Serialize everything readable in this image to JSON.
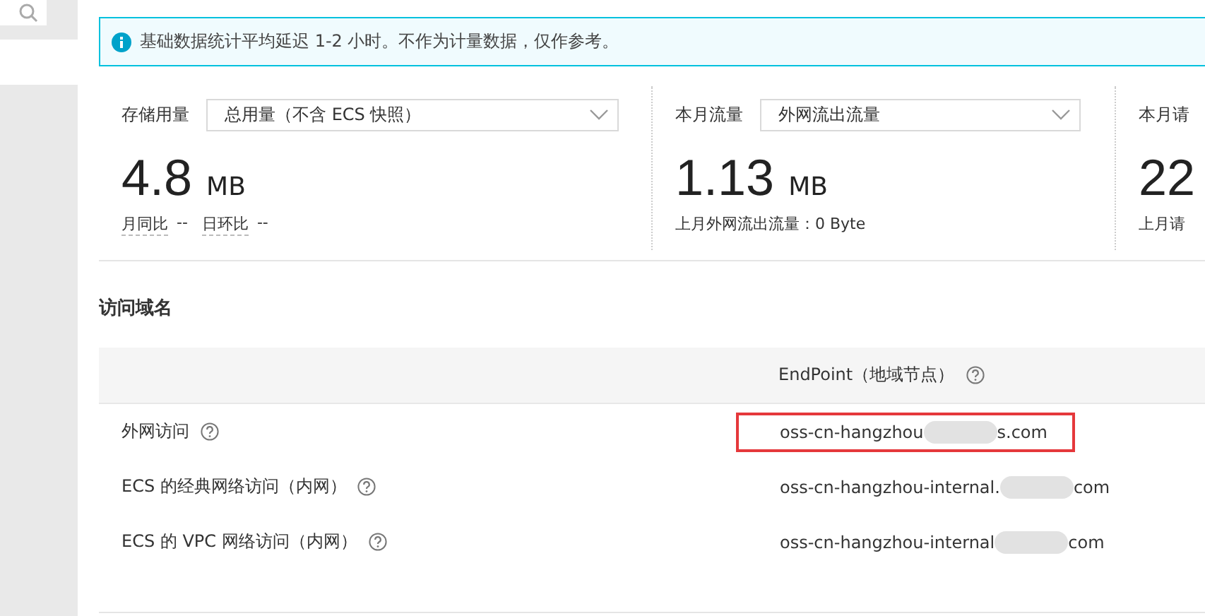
{
  "notice": {
    "text": "基础数据统计平均延迟 1-2 小时。不作为计量数据，仅作参考。"
  },
  "stats": [
    {
      "label": "存储用量",
      "select": "总用量（不含 ECS 快照）",
      "value": "4.8",
      "unit": "MB",
      "footer": [
        {
          "label": "月同比",
          "value": "--"
        },
        {
          "label": "日环比",
          "value": "--"
        }
      ]
    },
    {
      "label": "本月流量",
      "select": "外网流出流量",
      "value": "1.13",
      "unit": "MB",
      "footer": [
        {
          "label": "上月外网流出流量：0 Byte"
        }
      ]
    },
    {
      "label": "本月请",
      "value": "22",
      "footer": [
        {
          "label": "上月请"
        }
      ]
    }
  ],
  "section_title": "访问域名",
  "table": {
    "columns": [
      "EndPoint（地域节点）"
    ],
    "rows": [
      {
        "name": "外网访问",
        "prefix": "oss-cn-hangzhou",
        "suffix": "s.com",
        "highlighted": true
      },
      {
        "name": "ECS 的经典网络访问（内网）",
        "prefix": "oss-cn-hangzhou-internal.",
        "suffix": "com",
        "highlighted": false
      },
      {
        "name": "ECS 的 VPC 网络访问（内网）",
        "prefix": "oss-cn-hangzhou-internal",
        "suffix": "com",
        "highlighted": false
      }
    ]
  }
}
